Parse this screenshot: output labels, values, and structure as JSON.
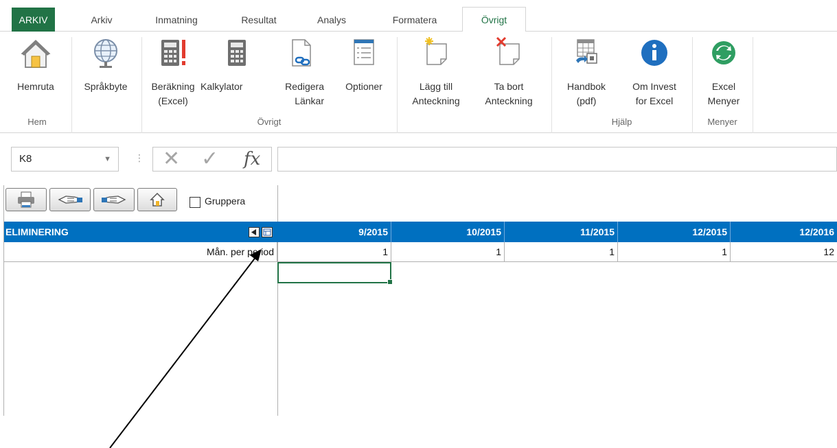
{
  "ribbon_tabs": [
    "ARKIV",
    "Arkiv",
    "Inmatning",
    "Resultat",
    "Analys",
    "Formatera",
    "Övrigt"
  ],
  "ribbon": {
    "buttons": {
      "hemruta": [
        "Hemruta",
        ""
      ],
      "sprakbyte": [
        "Språkbyte",
        ""
      ],
      "berakning": [
        "Beräkning",
        "(Excel)"
      ],
      "kalkylator": [
        "Kalkylator",
        ""
      ],
      "redigera": [
        "Redigera",
        "Länkar"
      ],
      "optioner": [
        "Optioner",
        ""
      ],
      "lagg_till": [
        "Lägg till",
        "Anteckning"
      ],
      "ta_bort": [
        "Ta bort",
        "Anteckning"
      ],
      "handbok": [
        "Handbok",
        "(pdf)"
      ],
      "om_invest": [
        "Om Invest",
        "for Excel"
      ],
      "excel_menyer": [
        "Excel",
        "Menyer"
      ]
    },
    "groups": {
      "hem": "Hem",
      "ovrigt": "Övrigt",
      "hjalp": "Hjälp",
      "menyer": "Menyer"
    }
  },
  "formula_bar": {
    "name_box": "K8",
    "fx_label": "fx",
    "cancel_glyph": "✕",
    "enter_glyph": "✓",
    "dots": "⋮",
    "formula": ""
  },
  "sheet": {
    "checkbox_label": "Gruppera",
    "header_label": "ELIMINERING",
    "periods": [
      "9/2015",
      "10/2015",
      "11/2015",
      "12/2015",
      "12/2016"
    ],
    "row_label": "Mån. per period",
    "row_values": [
      "1",
      "1",
      "1",
      "1",
      "12"
    ]
  },
  "colors": {
    "excel_green": "#217346",
    "header_blue": "#0070c0"
  },
  "icons": [
    "home-icon",
    "globe-icon",
    "calculator-alert-icon",
    "calculator-icon",
    "document-link-icon",
    "options-list-icon",
    "new-note-icon",
    "delete-note-icon",
    "handbook-icon",
    "info-icon",
    "refresh-icon",
    "printer-icon",
    "hand-back-icon",
    "hand-forward-icon",
    "small-home-icon"
  ]
}
